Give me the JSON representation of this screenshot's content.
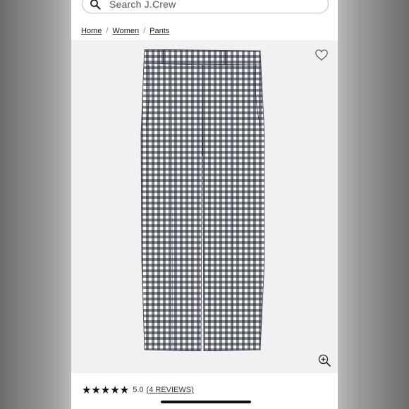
{
  "search": {
    "placeholder": "Search J.Crew",
    "icon": "search-icon"
  },
  "breadcrumb": [
    {
      "label": "Home"
    },
    {
      "label": "Women"
    },
    {
      "label": "Pants"
    }
  ],
  "breadcrumb_separator": "/",
  "product": {
    "image_alt": "gingham pants",
    "pattern_colors": {
      "dark": "#1e2533",
      "light": "#ffffff",
      "background": "#f1f1f1"
    },
    "wishlist_icon": "heart-icon",
    "zoom_icon": "zoom-in-icon"
  },
  "rating": {
    "stars": "★★★★★",
    "value": 5.0,
    "score_text": "5.0",
    "reviews_text": "(4 REVIEWS)",
    "icon": "star-icon"
  }
}
